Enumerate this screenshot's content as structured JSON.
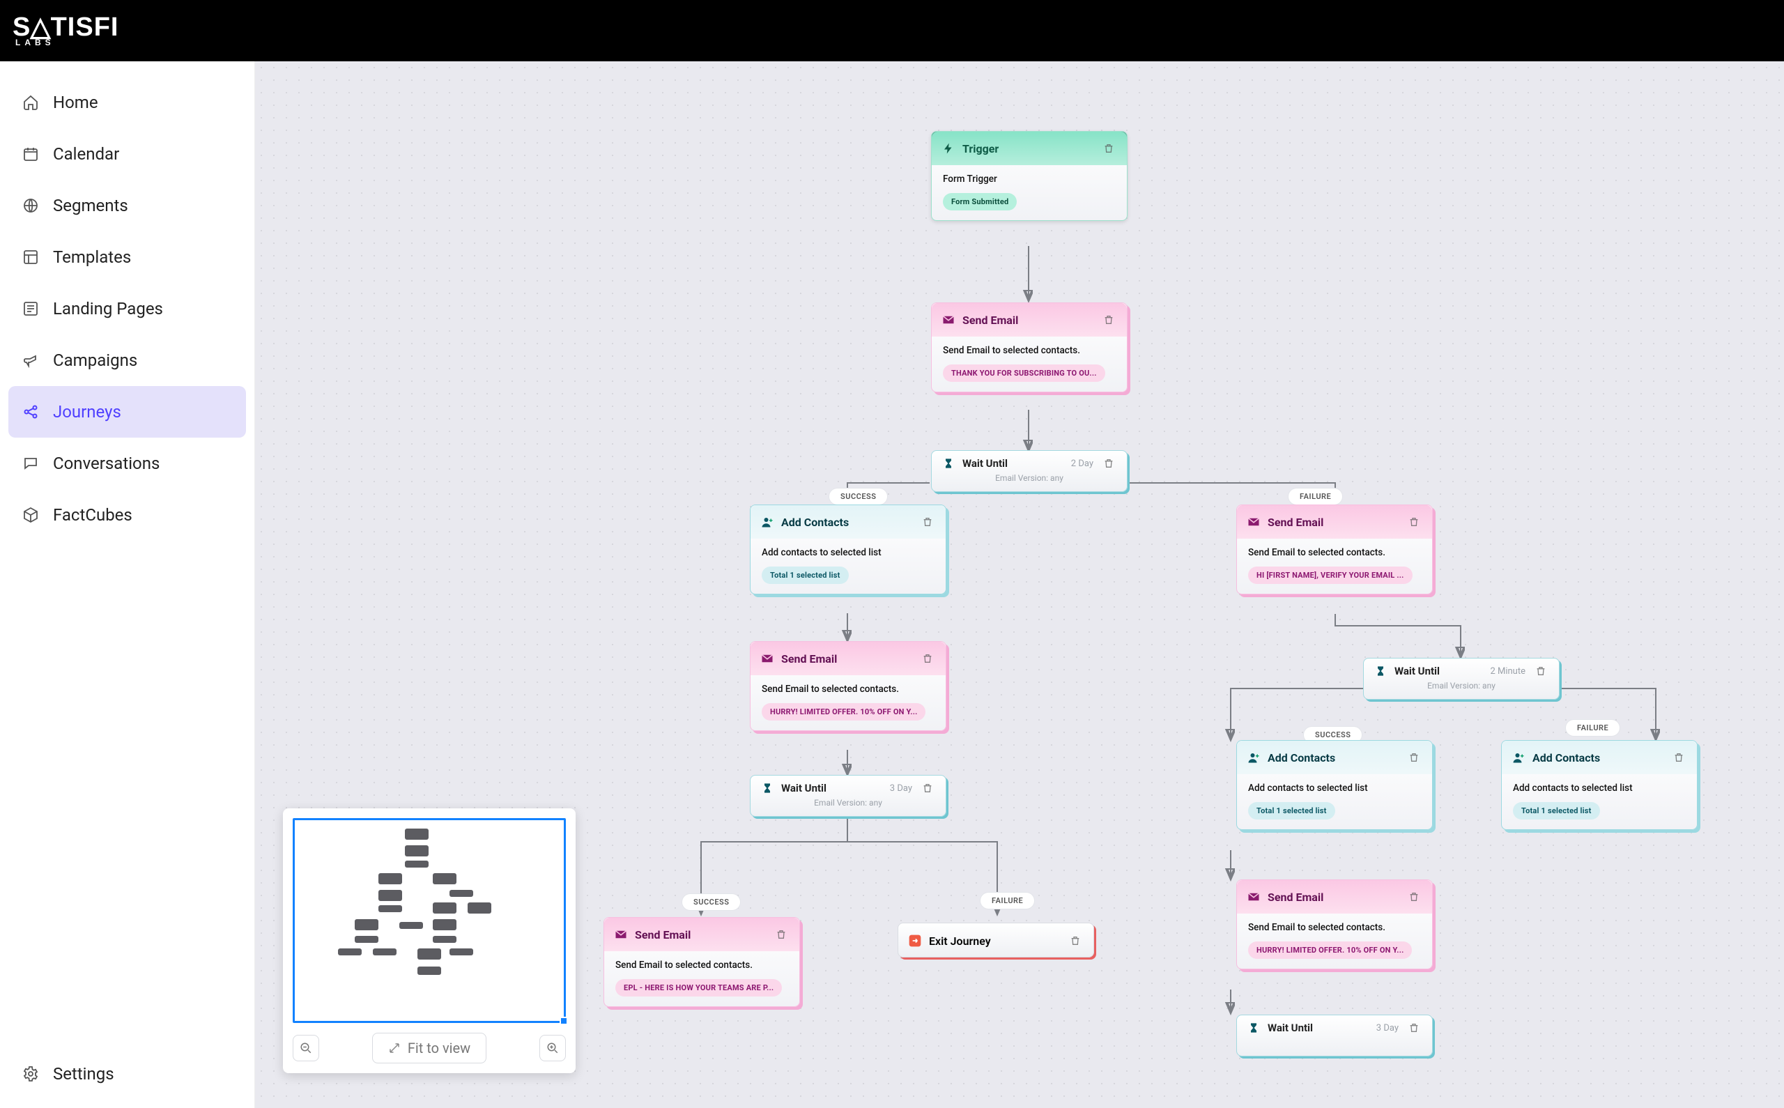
{
  "brand": {
    "main": "S△TISFI",
    "sub": "LABS"
  },
  "sidebar": {
    "items": [
      {
        "label": "Home"
      },
      {
        "label": "Calendar"
      },
      {
        "label": "Segments"
      },
      {
        "label": "Templates"
      },
      {
        "label": "Landing Pages"
      },
      {
        "label": "Campaigns"
      },
      {
        "label": "Journeys"
      },
      {
        "label": "Conversations"
      },
      {
        "label": "FactCubes"
      }
    ],
    "settings_label": "Settings"
  },
  "labels": {
    "success": "SUCCESS",
    "failure": "FAILURE",
    "fit_to_view": "Fit to view"
  },
  "nodes": {
    "trigger": {
      "title": "Trigger",
      "desc": "Form Trigger",
      "chip": "Form Submitted"
    },
    "send1": {
      "title": "Send Email",
      "desc": "Send Email to selected contacts.",
      "chip": "THANK YOU FOR SUBSCRIBING TO OU..."
    },
    "wait1": {
      "title": "Wait Until",
      "duration": "2 Day",
      "sub": "Email Version: any"
    },
    "addL": {
      "title": "Add Contacts",
      "desc": "Add contacts to selected list",
      "chip": "Total 1 selected list"
    },
    "sendR": {
      "title": "Send Email",
      "desc": "Send Email to selected contacts.",
      "chip": "HI [FIRST NAME], VERIFY YOUR EMAIL ..."
    },
    "sendL2": {
      "title": "Send Email",
      "desc": "Send Email to selected contacts.",
      "chip": "HURRY! LIMITED OFFER. 10% OFF ON Y..."
    },
    "waitR": {
      "title": "Wait Until",
      "duration": "2 Minute",
      "sub": "Email Version: any"
    },
    "waitL2": {
      "title": "Wait Until",
      "duration": "3 Day",
      "sub": "Email Version: any"
    },
    "addR1": {
      "title": "Add Contacts",
      "desc": "Add contacts to selected list",
      "chip": "Total 1 selected list"
    },
    "addR2": {
      "title": "Add Contacts",
      "desc": "Add contacts to selected list",
      "chip": "Total 1 selected list"
    },
    "sendL3": {
      "title": "Send Email",
      "desc": "Send Email to selected contacts.",
      "chip": "EPL - HERE IS HOW YOUR TEAMS ARE P..."
    },
    "exit": {
      "title": "Exit Journey"
    },
    "sendR2": {
      "title": "Send Email",
      "desc": "Send Email to selected contacts.",
      "chip": "HURRY! LIMITED OFFER. 10% OFF ON Y..."
    },
    "waitR2": {
      "title": "Wait Until",
      "duration": "3 Day"
    }
  }
}
